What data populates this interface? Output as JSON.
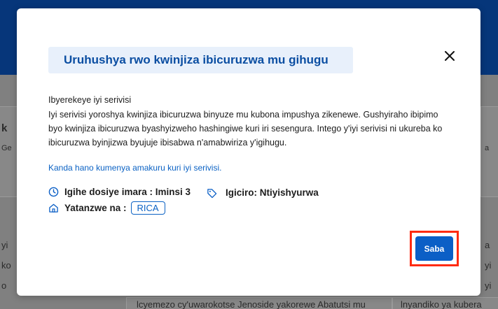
{
  "background": {
    "partial_texts": [
      "k",
      "Ge",
      "yi",
      "ko",
      "o",
      "lcyemezo cy'uwarokotse Jenoside yakorewe Abatutsi mu",
      "lnyandiko ya kubera",
      "a",
      "a",
      "yi",
      "yi"
    ]
  },
  "modal": {
    "title": "Uruhushya rwo kwinjiza ibicuruzwa mu gihugu",
    "close_icon": "close-icon",
    "description_heading": "Ibyerekeye iyi serivisi",
    "description_body": "Iyi serivisi yoroshya kwinjiza ibicuruzwa binyuze mu kubona impushya zikenewe. Gushyiraho ibipimo byo kwinjiza ibicuruzwa byashyizweho hashingiwe kuri iri sesengura. Intego y'iyi serivisi ni ukureba ko ibicuruzwa byinjizwa byujuje ibisabwa n'amabwiriza y'igihugu.",
    "more_link": "Kanda hano kumenya amakuru kuri iyi serivisi.",
    "processing_time": "Igihe dosiye imara : Iminsi 3",
    "cost": "Igiciro: Ntiyishyurwa",
    "provider_label": "Yatanzwe na :",
    "provider_value": "RICA",
    "apply_button": "Saba"
  },
  "colors": {
    "accent": "#0b5fc6",
    "title_bg": "#e8f0fb",
    "highlight": "#ff2b10"
  }
}
